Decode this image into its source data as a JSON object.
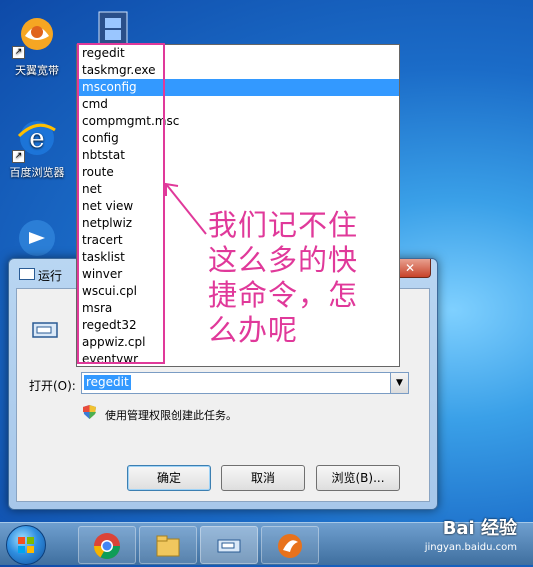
{
  "desktop": {
    "icons": [
      {
        "label": "天翼宽带",
        "icon": "tianyi-broadband-icon"
      },
      {
        "label": "百度浏览器",
        "icon": "baidu-browser-icon"
      },
      {
        "label": "",
        "icon": "media-player-icon"
      },
      {
        "label": "",
        "icon": "film-icon"
      }
    ]
  },
  "run_dialog": {
    "title": "运行",
    "close_label": "✕",
    "open_label": "打开(O):",
    "command_value": "regedit",
    "admin_note": "使用管理权限创建此任务。",
    "buttons": {
      "ok": "确定",
      "cancel": "取消",
      "browse": "浏览(B)..."
    }
  },
  "dropdown": {
    "items": [
      "regedit",
      "taskmgr.exe",
      "msconfig",
      "cmd",
      "compmgmt.msc",
      "config",
      "nbtstat",
      "route",
      "net",
      "net view",
      "netplwiz",
      "tracert",
      "tasklist",
      "winver",
      "wscui.cpl",
      "msra",
      "regedt32",
      "appwiz.cpl",
      "eventvwr"
    ],
    "selected_index": 2
  },
  "annotation": {
    "text": "我们记不住这么多的快捷命令，怎么办呢",
    "color": "#e0399a"
  },
  "taskbar": {
    "items": [
      "windows-start-icon",
      "chrome-icon",
      "file-explorer-icon",
      "run-app-icon",
      "browser-app-icon"
    ]
  },
  "watermark": {
    "brand": "Bai 经验",
    "url": "jingyan.baidu.com"
  }
}
